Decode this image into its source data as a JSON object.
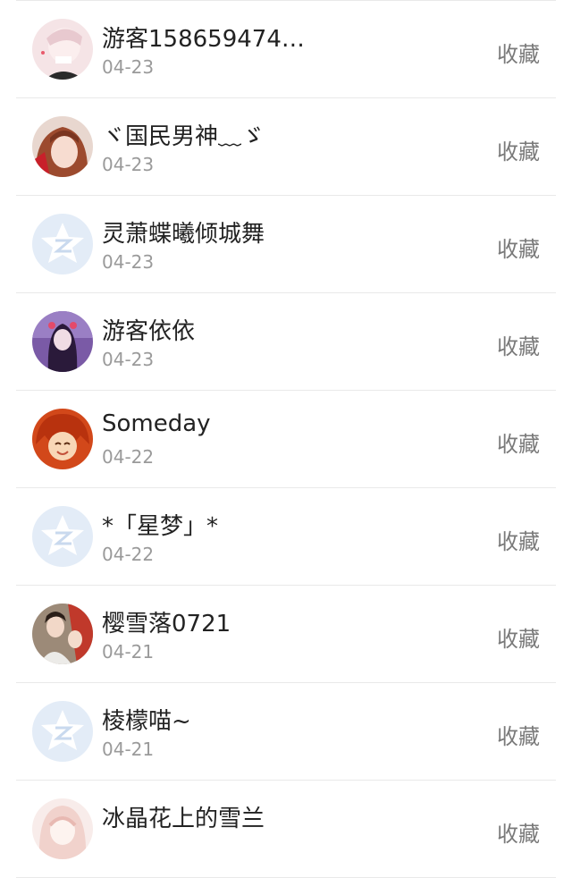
{
  "list": {
    "items": [
      {
        "name": "游客158659474…",
        "date": "04-23",
        "action": "收藏",
        "avatar": "anime-boy-avatar",
        "avatar_color": "#f3d9dd"
      },
      {
        "name": "ヾ国民男神﹏ゞ",
        "date": "04-23",
        "action": "收藏",
        "avatar": "girl-photo-avatar",
        "avatar_color": "#c97a5a"
      },
      {
        "name": "灵萧蝶曦倾城舞",
        "date": "04-23",
        "action": "收藏",
        "avatar": "default-star-avatar",
        "avatar_color": "#dfeaf6"
      },
      {
        "name": "游客依依",
        "date": "04-23",
        "action": "收藏",
        "avatar": "purple-girl-avatar",
        "avatar_color": "#6c3e8c"
      },
      {
        "name": "Someday",
        "date": "04-22",
        "action": "收藏",
        "avatar": "red-anime-avatar",
        "avatar_color": "#d9531f"
      },
      {
        "name": "*「星梦」*",
        "date": "04-22",
        "action": "收藏",
        "avatar": "default-star-avatar",
        "avatar_color": "#dfeaf6"
      },
      {
        "name": "樱雪落0721",
        "date": "04-21",
        "action": "收藏",
        "avatar": "couple-photo-avatar",
        "avatar_color": "#8a6f5c"
      },
      {
        "name": "棱檬喵~",
        "date": "04-21",
        "action": "收藏",
        "avatar": "default-star-avatar",
        "avatar_color": "#dfeaf6"
      },
      {
        "name": "冰晶花上的雪兰",
        "date": "",
        "action": "收藏",
        "avatar": "pink-anime-avatar",
        "avatar_color": "#f6e2e0"
      }
    ]
  }
}
